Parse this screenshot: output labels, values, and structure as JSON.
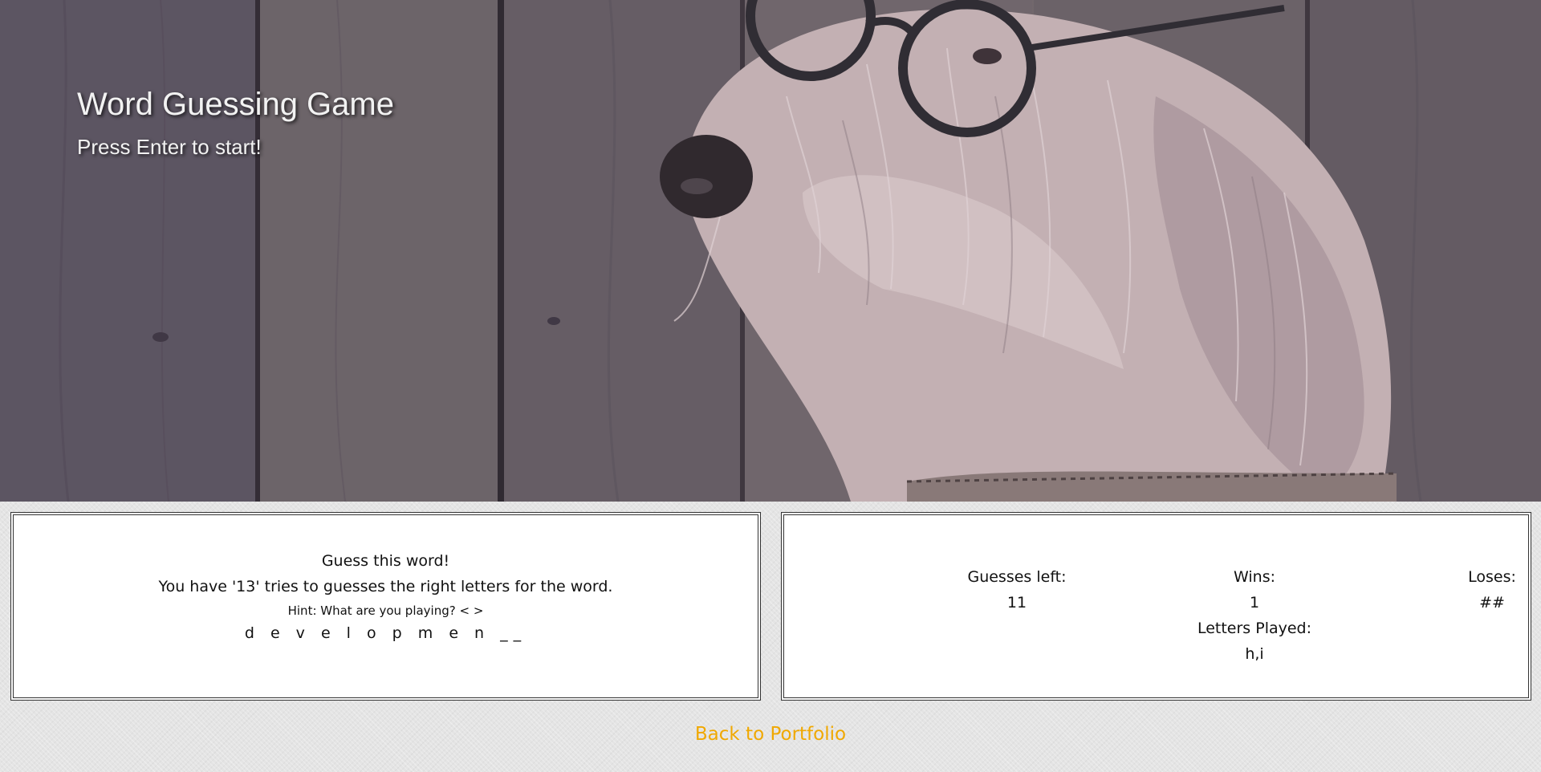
{
  "hero": {
    "title": "Word Guessing Game",
    "subtitle": "Press Enter to start!",
    "image": "dog-with-glasses-photo"
  },
  "game": {
    "prompt": "Guess this word!",
    "tries_text": "You have '13' tries to guesses the right letters for the word.",
    "hint": "Hint: What are you playing? < >",
    "word": "d e v e l o p m e n __"
  },
  "stats": {
    "guesses_label": "Guesses left:",
    "guesses_value": "11",
    "wins_label": "Wins:",
    "wins_value": "1",
    "loses_label": "Loses:",
    "loses_value": "##",
    "letters_label": "Letters Played:",
    "letters_value": "h,i"
  },
  "footer": {
    "back_link": "Back to Portfolio"
  },
  "colors": {
    "link": "#f0a800",
    "panel_bg": "#ffffff",
    "page_bg": "#e4e4e4"
  }
}
